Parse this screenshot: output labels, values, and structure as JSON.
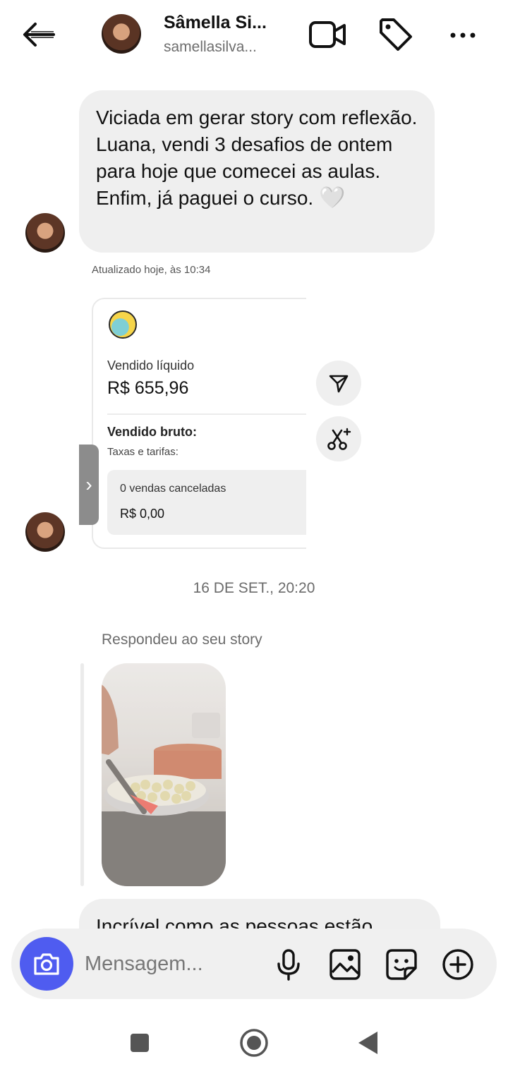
{
  "header": {
    "name": "Sâmella Si...",
    "username": "samellasilva..."
  },
  "messages": {
    "first": "Viciada em gerar story com reflexão. Luana, vendi 3 desafios de ontem para hoje que comecei as aulas. Enfim, já paguei o curso.",
    "first_emoji": "🤍",
    "shared_screenshot": {
      "updated": "Atualizado hoje, às 10:34",
      "net_label": "Vendido líquido",
      "net_value": "R$ 655,96",
      "gross_label": "Vendido bruto:",
      "fees_label": "Taxas e tarifas:",
      "cancelled_label": "0 vendas canceladas",
      "cancelled_value": "R$ 0,00"
    },
    "date_separator": "16 DE SET., 20:20",
    "reply_label": "Respondeu ao seu story",
    "last_partial": "Incrível como as pessoas estão"
  },
  "composer": {
    "placeholder": "Mensagem..."
  },
  "icons": {
    "back": "arrow-left-icon",
    "video": "video-call-icon",
    "tag": "tag-icon",
    "more": "more-horizontal-icon",
    "share": "send-icon",
    "remix": "ai-scissors-icon",
    "camera": "camera-icon",
    "mic": "microphone-icon",
    "gallery": "image-icon",
    "sticker": "sticker-icon",
    "plus": "plus-circle-icon"
  },
  "colors": {
    "camera_button": "#4f5cf0",
    "bubble": "#efefef"
  }
}
